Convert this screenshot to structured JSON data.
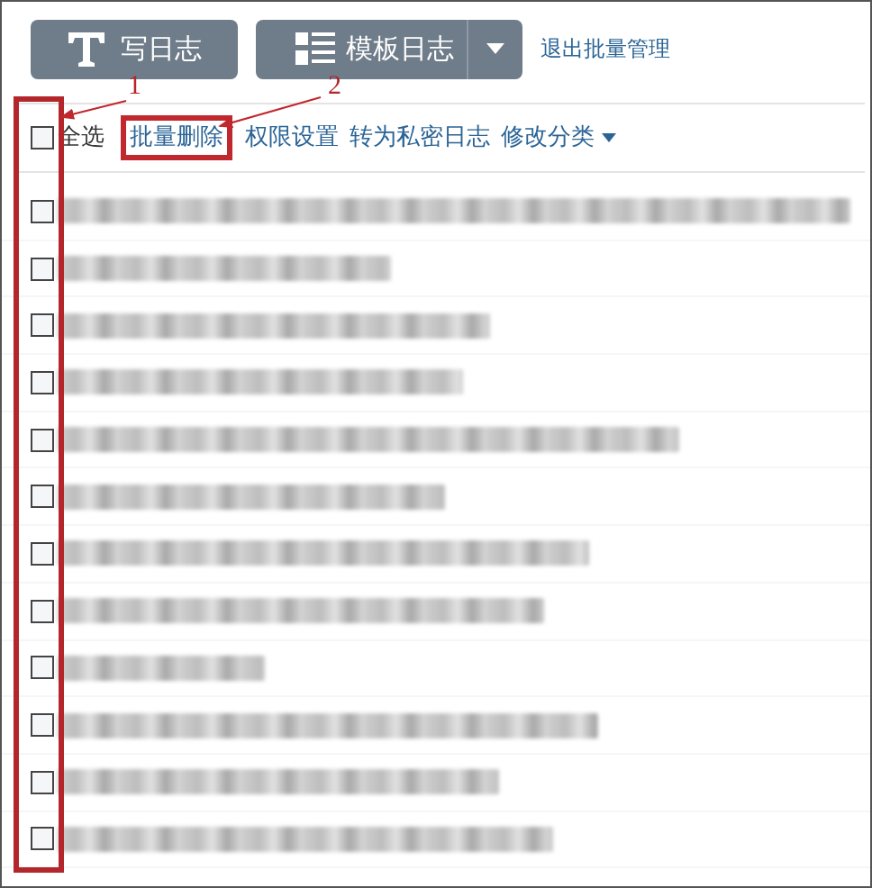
{
  "top_buttons": [
    {
      "kind": "write",
      "label": "写日志"
    },
    {
      "kind": "template",
      "label": "模板日志"
    }
  ],
  "exit_link": "退出批量管理",
  "toolbar": {
    "select_all": {
      "label": "全选",
      "checked": false
    },
    "actions": [
      {
        "label": "批量删除",
        "highlighted": true
      },
      {
        "label": "权限设置",
        "highlighted": false
      },
      {
        "label": "转为私密日志",
        "highlighted": false
      },
      {
        "label": "修改分类",
        "highlighted": false,
        "dropdown": true
      }
    ]
  },
  "annotations": [
    "1",
    "2"
  ],
  "entries": [
    {
      "checked": false
    },
    {
      "checked": false
    },
    {
      "checked": false
    },
    {
      "checked": false
    },
    {
      "checked": false
    },
    {
      "checked": false
    },
    {
      "checked": false
    },
    {
      "checked": false
    },
    {
      "checked": false
    },
    {
      "checked": false
    },
    {
      "checked": false
    },
    {
      "checked": false
    }
  ]
}
